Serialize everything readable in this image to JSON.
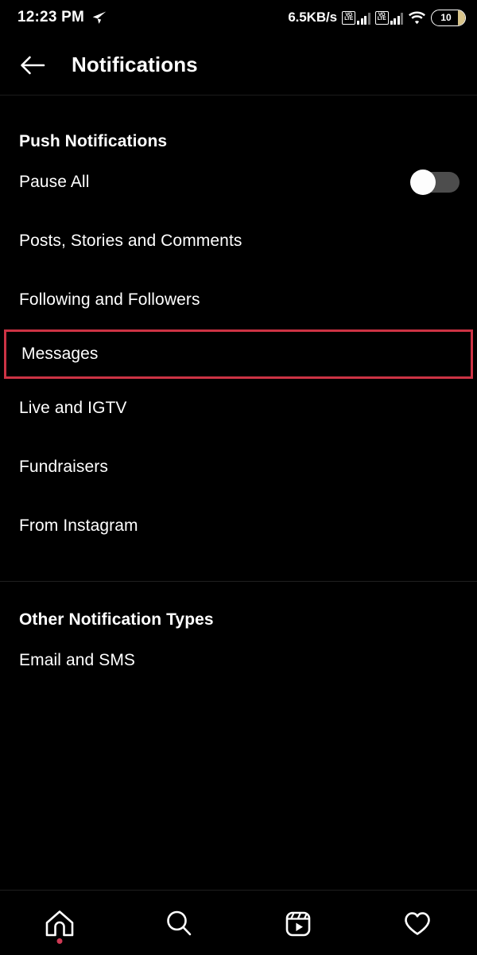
{
  "statusbar": {
    "time": "12:23 PM",
    "send_icon": "send-icon",
    "network_speed": "6.5KB/s",
    "sim1_label_top": "VO",
    "sim1_label_bottom": "LTE",
    "sim2_label_top": "VO",
    "sim2_label_bottom": "LTE",
    "wifi_icon": "wifi-icon",
    "battery_level": "10"
  },
  "header": {
    "back_icon": "arrow-left-icon",
    "title": "Notifications"
  },
  "sections": [
    {
      "title": "Push Notifications",
      "items": [
        {
          "label": "Pause All",
          "type": "toggle",
          "toggle_on": false
        },
        {
          "label": "Posts, Stories and Comments",
          "type": "link"
        },
        {
          "label": "Following and Followers",
          "type": "link"
        },
        {
          "label": "Messages",
          "type": "link",
          "highlighted": true
        },
        {
          "label": "Live and IGTV",
          "type": "link"
        },
        {
          "label": "Fundraisers",
          "type": "link"
        },
        {
          "label": "From Instagram",
          "type": "link"
        }
      ]
    },
    {
      "title": "Other Notification Types",
      "items": [
        {
          "label": "Email and SMS",
          "type": "link"
        }
      ]
    }
  ],
  "bottom_nav": [
    {
      "icon": "home-icon",
      "badge_dot": true
    },
    {
      "icon": "search-icon",
      "badge_dot": false
    },
    {
      "icon": "reels-icon",
      "badge_dot": false
    },
    {
      "icon": "heart-icon",
      "badge_dot": false
    }
  ],
  "colors": {
    "background": "#000000",
    "text": "#ffffff",
    "highlight_border": "#cc3344",
    "divider": "#1f1f1f",
    "toggle_track": "#4d4d4d",
    "toggle_knob": "#fdfdfd",
    "nav_dot": "#d03a55",
    "battery_fill": "#d8c48a"
  }
}
